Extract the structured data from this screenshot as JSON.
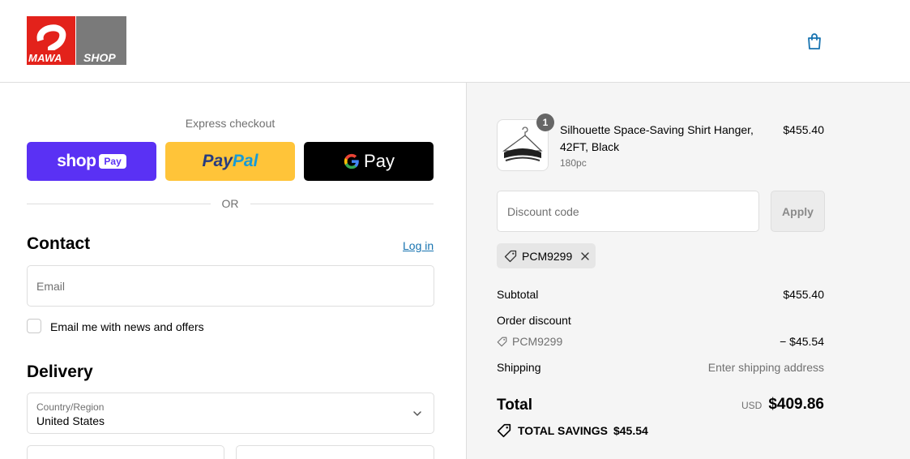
{
  "header": {
    "logo_left": "MAWA",
    "logo_right": "SHOP",
    "cart_icon": "shopping-bag-icon"
  },
  "colors": {
    "accent_link": "#1773b0",
    "shop_pay": "#5a31f4",
    "paypal_yellow": "#ffc439",
    "gpay_black": "#000000",
    "logo_red": "#e3221b",
    "logo_gray": "#7a7a7a"
  },
  "express": {
    "label": "Express checkout",
    "shop": "shop",
    "shop_pay_pill": "Pay",
    "paypal_pay": "Pay",
    "paypal_pal": "Pal",
    "gpay_g": "G",
    "gpay_pay": "Pay",
    "or": "OR"
  },
  "contact": {
    "title": "Contact",
    "login": "Log in",
    "email_placeholder": "Email",
    "newsletter_label": "Email me with news and offers"
  },
  "delivery": {
    "title": "Delivery",
    "country_label": "Country/Region",
    "country_value": "United States"
  },
  "order": {
    "item": {
      "quantity": "1",
      "name": "Silhouette Space-Saving Shirt Hanger, 42FT, Black",
      "variant": "180pc",
      "price": "$455.40"
    },
    "discount_placeholder": "Discount code",
    "apply": "Apply",
    "applied_code": "PCM9299",
    "subtotal_label": "Subtotal",
    "subtotal_value": "$455.40",
    "order_discount_label": "Order discount",
    "order_discount_code": "PCM9299",
    "order_discount_value": "− $45.54",
    "shipping_label": "Shipping",
    "shipping_value": "Enter shipping address",
    "total_label": "Total",
    "total_currency": "USD",
    "total_value": "$409.86",
    "savings_label": "TOTAL SAVINGS",
    "savings_value": "$45.54"
  }
}
